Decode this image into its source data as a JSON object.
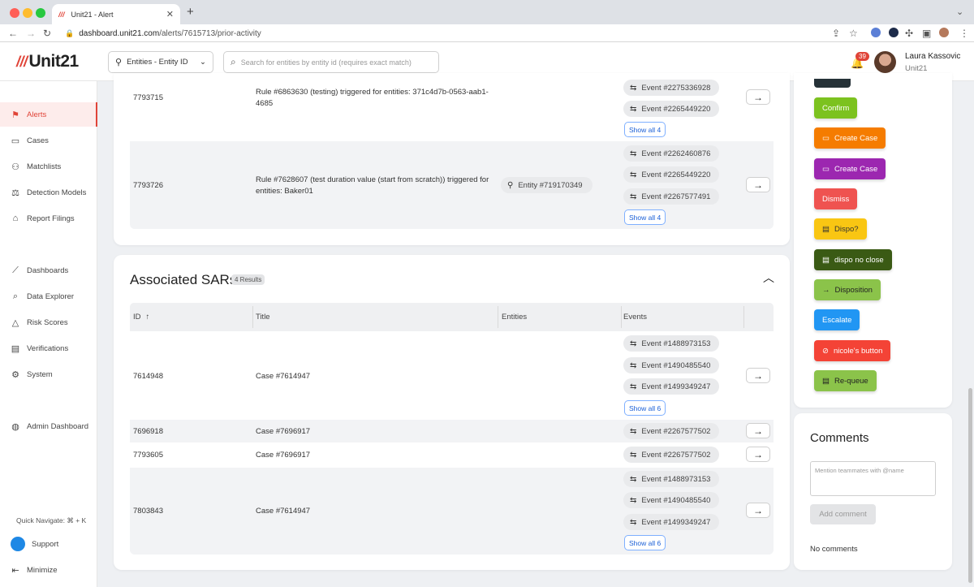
{
  "browser": {
    "tab_title": "Unit21 - Alert",
    "url_domain": "dashboard.unit21.com",
    "url_path": "/alerts/7615713/prior-activity"
  },
  "header": {
    "logo": "Unit21",
    "entity_select": "Entities - Entity ID",
    "search_placeholder": "Search for entities by entity id (requires exact match)",
    "notifications_count": "39",
    "user_name": "Laura Kassovic",
    "user_org": "Unit21"
  },
  "sidebar": {
    "items": [
      {
        "label": "Alerts",
        "icon": "flag-icon"
      },
      {
        "label": "Cases",
        "icon": "briefcase-icon"
      },
      {
        "label": "Matchlists",
        "icon": "user-plus-icon"
      },
      {
        "label": "Detection Models",
        "icon": "scale-icon"
      },
      {
        "label": "Report Filings",
        "icon": "bank-icon"
      },
      {
        "label": "Dashboards",
        "icon": "chart-line-icon"
      },
      {
        "label": "Data Explorer",
        "icon": "data-search-icon"
      },
      {
        "label": "Risk Scores",
        "icon": "warning-icon"
      },
      {
        "label": "Verifications",
        "icon": "id-card-icon"
      },
      {
        "label": "System",
        "icon": "gear-icon"
      },
      {
        "label": "Admin Dashboard",
        "icon": "globe-icon"
      }
    ],
    "quick_navigate": "Quick Navigate: ⌘ + K",
    "support": "Support",
    "minimize": "Minimize"
  },
  "prior_alerts": {
    "rows": [
      {
        "id": "7793715",
        "title": "Rule #6863630 (testing) triggered for entities: 371c4d7b-0563-aab1-4685",
        "entity": "",
        "events": [
          "Event #2275336928",
          "Event #2265449220"
        ],
        "show_all": "Show all 4"
      },
      {
        "id": "7793726",
        "title": "Rule #7628607 (test duration value (start from scratch)) triggered for entities: Baker01",
        "entity": "Entity #719170349",
        "events": [
          "Event #2262460876",
          "Event #2265449220",
          "Event #2267577491"
        ],
        "show_all": "Show all 4"
      }
    ]
  },
  "sars": {
    "title": "Associated SARs",
    "count": "4 Results",
    "columns": [
      "ID",
      "Title",
      "Entities",
      "Events"
    ],
    "rows": [
      {
        "id": "7614948",
        "title": "Case #7614947",
        "events": [
          "Event #1488973153",
          "Event #1490485540",
          "Event #1499349247"
        ],
        "show_all": "Show all 6"
      },
      {
        "id": "7696918",
        "title": "Case #7696917",
        "events": [
          "Event #2267577502"
        ],
        "show_all": ""
      },
      {
        "id": "7793605",
        "title": "Case #7696917",
        "events": [
          "Event #2267577502"
        ],
        "show_all": ""
      },
      {
        "id": "7803843",
        "title": "Case #7614947",
        "events": [
          "Event #1488973153",
          "Event #1490485540",
          "Event #1499349247"
        ],
        "show_all": "Show all 6"
      }
    ]
  },
  "actions": [
    {
      "label": "Confirm",
      "color": "#7cc21f",
      "icon": ""
    },
    {
      "label": "Create Case",
      "color": "#f57c00",
      "icon": "briefcase-icon"
    },
    {
      "label": "Create Case",
      "color": "#9c27b0",
      "icon": "briefcase-icon"
    },
    {
      "label": "Dismiss",
      "color": "#ef5350",
      "icon": ""
    },
    {
      "label": "Dispo?",
      "color": "#f9c613",
      "icon": "clipboard-icon"
    },
    {
      "label": "dispo no close",
      "color": "#3a5a14",
      "icon": "clipboard-icon"
    },
    {
      "label": "Disposition",
      "color": "#8bc34a",
      "icon": "arrow-right-icon"
    },
    {
      "label": "Escalate",
      "color": "#2196f3",
      "icon": ""
    },
    {
      "label": "nicole's button",
      "color": "#f44336",
      "icon": "check-circle-icon"
    },
    {
      "label": "Re-queue",
      "color": "#8bc34a",
      "icon": "clipboard-icon"
    }
  ],
  "comments": {
    "title": "Comments",
    "placeholder": "Mention teammates with @name",
    "add_button": "Add comment",
    "empty": "No comments"
  }
}
